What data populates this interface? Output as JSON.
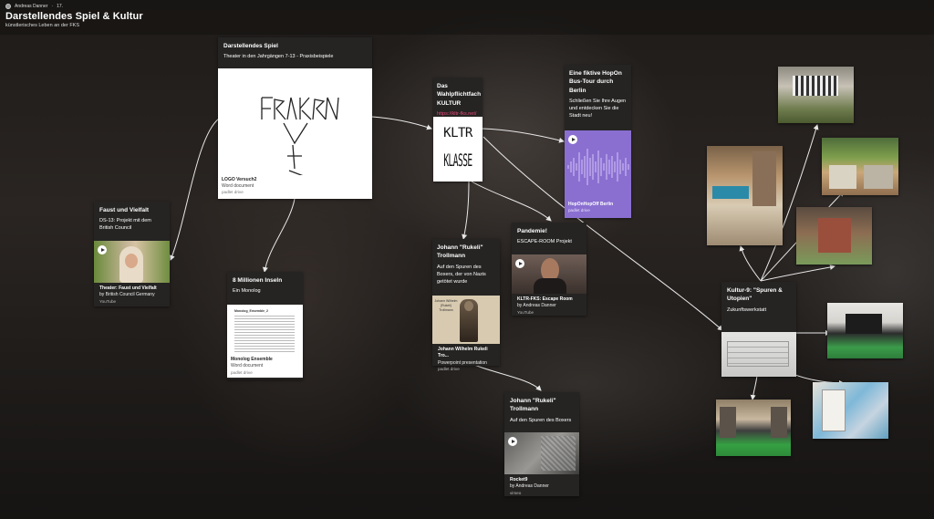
{
  "header": {
    "author": "Andreas Danner",
    "sep": "·",
    "count": "17.",
    "title": "Darstellendes Spiel & Kultur",
    "subtitle": "künstlerisches Leben an der FKS"
  },
  "cards": {
    "ds": {
      "title": "Darstellendes Spiel",
      "body": "Theater in den Jahrgängen 7-13 - Praxisbeispiele",
      "att_name": "LOGO Versuch2",
      "att_kind": "Word document",
      "att_src": "padlet drive"
    },
    "faust": {
      "title": "Faust und Vielfalt",
      "body": "DS-13: Projekt mit dem British Council",
      "att_name": "Theater: Faust und Vielfalt",
      "att_kind": "by British Council Germany",
      "att_src": "YouTube"
    },
    "inseln": {
      "title": "8 Millionen Inseln",
      "body": "Ein Monolog",
      "att_name": "Monolog Ensemble",
      "att_kind": "Word document",
      "att_src": "padlet drive",
      "doc_title": "Monolog_Ensemble_2"
    },
    "kultur": {
      "title": "Das Wahlpflichtfach KULTUR",
      "link": "https://kltr-fks.net/",
      "logo_top": "KLTR",
      "logo_bottom": "KLASSE"
    },
    "hopon": {
      "title": "Eine fiktive HopOn Bus-Tour durch Berlin",
      "body": "Schließen Sie Ihre Augen und entdecken Sie die Stadt neu!",
      "att_name": "HopOnHopOff Berlin",
      "att_src": "padlet drive"
    },
    "pandemie": {
      "title": "Pandemie!",
      "body": "ESCAPE-ROOM Projekt",
      "att_name": "KLTR-FKS: Escape Room",
      "att_kind": "by Andreas Danner",
      "att_src": "YouTube"
    },
    "rukeli1": {
      "title": "Johann \"Rukeli\" Trollmann",
      "body": "Auf den Spuren des Boxers, der von Nazis getötet wurde",
      "att_name": "Johann Wilhelm Rukeli Tro...",
      "att_kind": "Powerpoint presentation",
      "att_src": "padlet drive",
      "thumb_title": "Johann Wilhelm (Rukeli) Trollmann"
    },
    "rukeli2": {
      "title": "Johann \"Rukeli\" Trollmann",
      "body": "Auf den Spuren des Boxers",
      "att_name": "Rocket9",
      "att_kind": "by Andreas Danner",
      "att_src": "vimeo"
    },
    "kultur9": {
      "title": "Kultur-9: \"Spuren & Utopien\"",
      "body": "Zukunftswerkstatt"
    }
  },
  "colors": {
    "card_bg": "#252423",
    "link": "#e5457a",
    "hopon_purple": "#8a6fd1",
    "arrow": "#e8e8e8"
  }
}
